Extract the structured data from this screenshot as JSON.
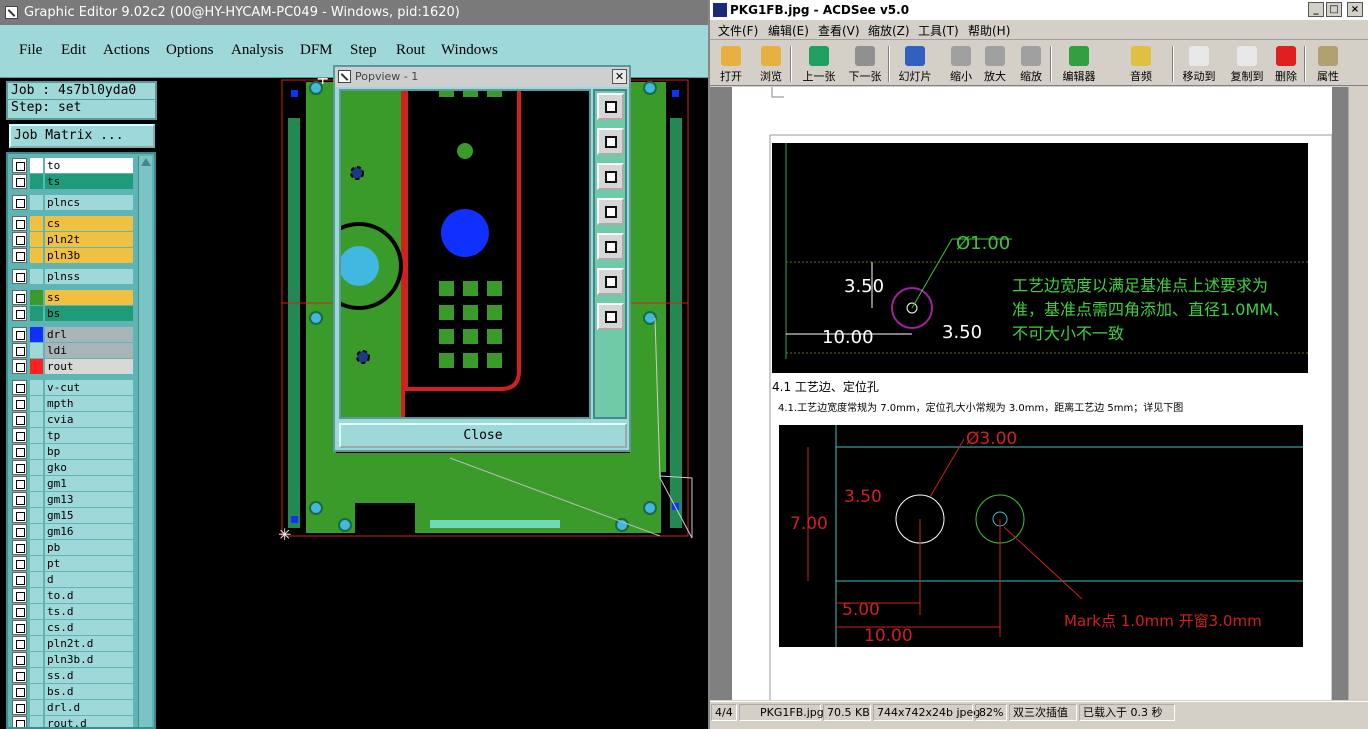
{
  "ge": {
    "title": "Graphic Editor 9.02c2 (00@HY-HYCAM-PC049 - Windows, pid:1620)",
    "menu": [
      "File",
      "Edit",
      "Actions",
      "Options",
      "Analysis",
      "DFM",
      "Step",
      "Rout",
      "Windows"
    ],
    "job_label": "Job : 4s7bl0yda0",
    "step_label": "Step: set",
    "job_matrix_button": "Job Matrix ...",
    "layers": [
      {
        "name": "to",
        "color": "#ffffff",
        "name_bg": "#ffffff"
      },
      {
        "name": "ts",
        "color": "#1f9b7a",
        "name_bg": "#1f9b7a"
      },
      {
        "name": "plncs",
        "color": "#9fd8d8",
        "name_bg": "#9fd8d8"
      },
      {
        "name": "cs",
        "color": "#f0c040",
        "name_bg": "#f0c040"
      },
      {
        "name": "pln2t",
        "color": "#f0c040",
        "name_bg": "#f0c040"
      },
      {
        "name": "pln3b",
        "color": "#f0c040",
        "name_bg": "#f0c040"
      },
      {
        "name": "plnss",
        "color": "#9fd8d8",
        "name_bg": "#9fd8d8"
      },
      {
        "name": "ss",
        "color": "#3a9a2a",
        "name_bg": "#f0c040"
      },
      {
        "name": "bs",
        "color": "#1f9b7a",
        "name_bg": "#1f9b7a"
      },
      {
        "name": "drl",
        "color": "#1030ff",
        "name_bg": "#a8b4b8"
      },
      {
        "name": "ldi",
        "color": "#9fd8d8",
        "name_bg": "#a8b4b8"
      },
      {
        "name": "rout",
        "color": "#ff2020",
        "name_bg": "#d8d8d8"
      },
      {
        "name": "v-cut",
        "color": "#9fd8d8",
        "name_bg": "#9fd8d8"
      },
      {
        "name": "mpth",
        "color": "#9fd8d8",
        "name_bg": "#9fd8d8"
      },
      {
        "name": "cvia",
        "color": "#9fd8d8",
        "name_bg": "#9fd8d8"
      },
      {
        "name": "tp",
        "color": "#9fd8d8",
        "name_bg": "#9fd8d8"
      },
      {
        "name": "bp",
        "color": "#9fd8d8",
        "name_bg": "#9fd8d8"
      },
      {
        "name": "gko",
        "color": "#9fd8d8",
        "name_bg": "#9fd8d8"
      },
      {
        "name": "gm1",
        "color": "#9fd8d8",
        "name_bg": "#9fd8d8"
      },
      {
        "name": "gm13",
        "color": "#9fd8d8",
        "name_bg": "#9fd8d8"
      },
      {
        "name": "gm15",
        "color": "#9fd8d8",
        "name_bg": "#9fd8d8"
      },
      {
        "name": "gm16",
        "color": "#9fd8d8",
        "name_bg": "#9fd8d8"
      },
      {
        "name": "pb",
        "color": "#9fd8d8",
        "name_bg": "#9fd8d8"
      },
      {
        "name": "pt",
        "color": "#9fd8d8",
        "name_bg": "#9fd8d8"
      },
      {
        "name": "d",
        "color": "#9fd8d8",
        "name_bg": "#9fd8d8"
      },
      {
        "name": "to.d",
        "color": "#9fd8d8",
        "name_bg": "#9fd8d8"
      },
      {
        "name": "ts.d",
        "color": "#9fd8d8",
        "name_bg": "#9fd8d8"
      },
      {
        "name": "cs.d",
        "color": "#9fd8d8",
        "name_bg": "#9fd8d8"
      },
      {
        "name": "pln2t.d",
        "color": "#9fd8d8",
        "name_bg": "#9fd8d8"
      },
      {
        "name": "pln3b.d",
        "color": "#9fd8d8",
        "name_bg": "#9fd8d8"
      },
      {
        "name": "ss.d",
        "color": "#9fd8d8",
        "name_bg": "#9fd8d8"
      },
      {
        "name": "bs.d",
        "color": "#9fd8d8",
        "name_bg": "#9fd8d8"
      },
      {
        "name": "drl.d",
        "color": "#9fd8d8",
        "name_bg": "#9fd8d8"
      },
      {
        "name": "rout.d",
        "color": "#9fd8d8",
        "name_bg": "#9fd8d8"
      }
    ],
    "popview_title": "Popview - 1",
    "popview_close": "Close",
    "popview_close_x": "✕",
    "pv_tool_icons": [
      "zoom-home-icon",
      "pan-up-icon",
      "pan-down-icon",
      "pan-left-icon",
      "pan-right-icon",
      "fit-icon",
      "expand-icon"
    ]
  },
  "acd": {
    "title": "PKG1FB.jpg - ACDSee v5.0",
    "window_buttons": [
      "_",
      "□",
      "×"
    ],
    "menu": [
      "文件(F)",
      "编辑(E)",
      "查看(V)",
      "缩放(Z)",
      "工具(T)",
      "帮助(H)"
    ],
    "toolbar": [
      {
        "label": "打开",
        "icon": "open-folder-icon",
        "color": "#e8b040"
      },
      {
        "label": "浏览",
        "icon": "browse-icon",
        "color": "#e8b040"
      },
      {
        "label": "上一张",
        "icon": "previous-icon",
        "color": "#20a060"
      },
      {
        "label": "下一张",
        "icon": "next-icon",
        "color": "#909090"
      },
      {
        "label": "幻灯片",
        "icon": "slideshow-icon",
        "color": "#3060c0"
      },
      {
        "label": "缩小",
        "icon": "zoom-out-icon",
        "color": "#a0a0a0"
      },
      {
        "label": "放大",
        "icon": "zoom-in-icon",
        "color": "#a0a0a0"
      },
      {
        "label": "缩放",
        "icon": "zoom-icon",
        "color": "#a0a0a0"
      },
      {
        "label": "编辑器",
        "icon": "editor-icon",
        "color": "#30a040"
      },
      {
        "label": "音频",
        "icon": "audio-icon",
        "color": "#e0c040"
      },
      {
        "label": "移动到",
        "icon": "move-to-icon",
        "color": "#e8e8e8"
      },
      {
        "label": "复制到",
        "icon": "copy-to-icon",
        "color": "#e8e8e8"
      },
      {
        "label": "删除",
        "icon": "delete-icon",
        "color": "#e02020"
      },
      {
        "label": "属性",
        "icon": "properties-icon",
        "color": "#b0a070"
      }
    ],
    "status": [
      "4/4",
      "PKG1FB.jpg",
      "70.5 KB",
      "744x742x24b jpeg",
      "82%",
      "双三次插值",
      "已载入于 0.3 秒"
    ],
    "doc": {
      "fig1": {
        "dia": "Ø1.00",
        "dim_a": "3.50",
        "dim_b": "3.50",
        "dim_c": "10.00",
        "note_line1": "工艺边宽度以满足基准点上述要求为",
        "note_line2": "准，基准点需四角添加、直径1.0MM、",
        "note_line3": "不可大小不一致"
      },
      "heading": "4.1 工艺边、定位孔",
      "para": "4.1.工艺边宽度常规为 7.0mm，定位孔大小常规为 3.0mm，距离工艺边 5mm；详见下图",
      "fig2": {
        "dia": "Ø3.00",
        "dim_a": "3.50",
        "dim_b": "7.00",
        "dim_c": "5.00",
        "dim_d": "10.00",
        "mark": "Mark点 1.0mm 开窗3.0mm"
      }
    }
  }
}
